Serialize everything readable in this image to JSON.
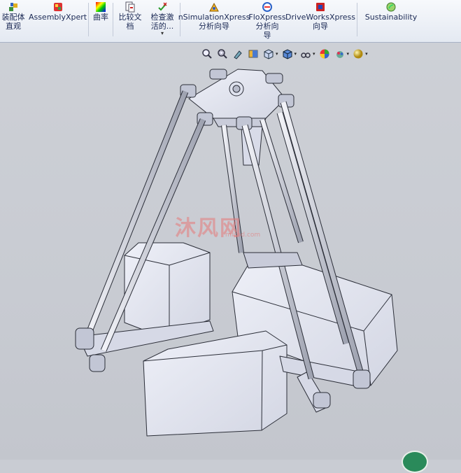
{
  "ribbon": {
    "buttons": [
      {
        "id": "assembly-visualization",
        "line1": "装配体",
        "line2": "直观",
        "icon": "assembly-visualization-icon"
      },
      {
        "id": "assemblyxpert",
        "line1": "AssemblyXpert",
        "line2": "",
        "icon": "assemblyxpert-icon"
      },
      {
        "id": "curvature",
        "line1": "曲率",
        "line2": "",
        "icon": "curvature-icon"
      },
      {
        "id": "compare-documents",
        "line1": "比较文",
        "line2": "档",
        "icon": "compare-documents-icon"
      },
      {
        "id": "check-active",
        "line1": "检查激",
        "line2": "活的...",
        "icon": "check-active-icon"
      },
      {
        "id": "simulationxpress",
        "line1": "nSimulationXpress",
        "line2": "分析向导",
        "icon": "simulationxpress-icon"
      },
      {
        "id": "floxpress",
        "line1": "FloXpress",
        "line2": "分析向",
        "line3": "导",
        "icon": "floxpress-icon"
      },
      {
        "id": "driveworksxpress",
        "line1": "DriveWorksXpress",
        "line2": "向导",
        "icon": "driveworksxpress-icon"
      },
      {
        "id": "sustainability",
        "line1": "Sustainability",
        "line2": "",
        "icon": "sustainability-icon"
      }
    ]
  },
  "heads_up_toolbar": {
    "tools": [
      "zoom-to-fit-icon",
      "zoom-to-area-icon",
      "previous-view-icon",
      "section-view-icon",
      "view-orientation-icon",
      "display-style-icon",
      "hide-show-items-icon",
      "edit-appearance-icon",
      "apply-scene-icon",
      "view-settings-icon"
    ]
  },
  "watermark": {
    "text": "沐风网",
    "sub": "mfcad.com"
  },
  "colors": {
    "ribbon_text": "#1c2a55",
    "viewport_bg": "#c9ccd3",
    "model_face": "#e9ebf4",
    "model_edge": "#2b2e38"
  }
}
